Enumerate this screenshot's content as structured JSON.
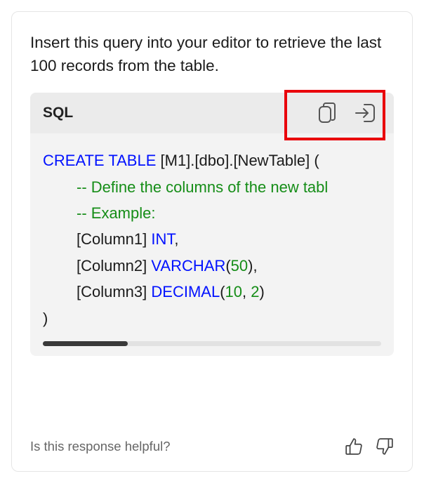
{
  "intro": "Insert this query into your editor to retrieve the last 100 records from the table.",
  "codeblock": {
    "language": "SQL",
    "tokens": [
      [
        {
          "t": "CREATE TABLE",
          "c": "kw"
        },
        {
          "t": " [M1].[dbo].[NewTable] ("
        }
      ],
      [
        {
          "indent": true
        },
        {
          "t": "-- Define the columns of the new tabl",
          "c": "cm"
        }
      ],
      [
        {
          "indent": true
        },
        {
          "t": "-- Example:",
          "c": "cm"
        }
      ],
      [
        {
          "indent": true
        },
        {
          "t": "[Column1] "
        },
        {
          "t": "INT",
          "c": "kw"
        },
        {
          "t": ","
        }
      ],
      [
        {
          "indent": true
        },
        {
          "t": "[Column2] "
        },
        {
          "t": "VARCHAR",
          "c": "kw"
        },
        {
          "t": "("
        },
        {
          "t": "50",
          "c": "num"
        },
        {
          "t": "),"
        }
      ],
      [
        {
          "indent": true
        },
        {
          "t": "[Column3] "
        },
        {
          "t": "DECIMAL",
          "c": "kw"
        },
        {
          "t": "("
        },
        {
          "t": "10",
          "c": "num"
        },
        {
          "t": ", "
        },
        {
          "t": "2",
          "c": "num"
        },
        {
          "t": ")"
        }
      ],
      [
        {
          "t": ")"
        }
      ]
    ]
  },
  "feedback": {
    "prompt": "Is this response helpful?"
  }
}
